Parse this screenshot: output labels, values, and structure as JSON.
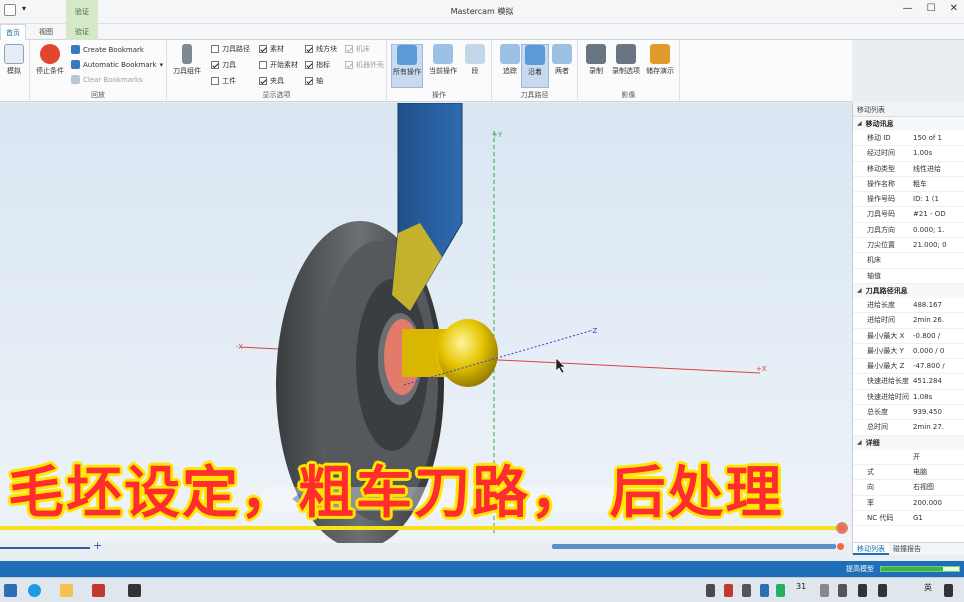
{
  "app": {
    "title": "Mastercam 模拟",
    "context_tab": "验证"
  },
  "tabs": [
    {
      "label": "首页"
    },
    {
      "label": "视图"
    },
    {
      "label": "验证"
    }
  ],
  "ribbon": {
    "sim_label": "模拟",
    "replay": {
      "stop_label": "停止条件",
      "create_bookmark": "Create Bookmark",
      "auto_bookmark": "Automatic Bookmark",
      "clear_bookmarks": "Clear Bookmarks",
      "group": "回放"
    },
    "display": {
      "tool_set": "刀具组件",
      "cols": [
        [
          {
            "label": "刀具路径",
            "checked": false
          },
          {
            "label": "刀具",
            "checked": true
          },
          {
            "label": "工件",
            "checked": false
          }
        ],
        [
          {
            "label": "素材",
            "checked": true
          },
          {
            "label": "开始素材",
            "checked": false
          },
          {
            "label": "夹具",
            "checked": true
          }
        ],
        [
          {
            "label": "线方块",
            "checked": true
          },
          {
            "label": "指标",
            "checked": true
          },
          {
            "label": "轴",
            "checked": true
          }
        ],
        [
          {
            "label": "机床",
            "checked": true,
            "disabled": true
          },
          {
            "label": "机器外壳",
            "checked": true,
            "disabled": true
          }
        ]
      ],
      "group": "显示选项"
    },
    "operation": {
      "all_ops": "所有操作",
      "current_op": "当前操作",
      "segment": "段",
      "group": "操作"
    },
    "toolpath": {
      "trace": "追踪",
      "follow": "沿着",
      "both": "两者",
      "group": "刀具路径"
    },
    "video": {
      "record": "录制",
      "record_options": "录制选项",
      "save_demo": "储存演示",
      "group": "影像"
    }
  },
  "panel": {
    "title": "移动列表",
    "section_move": "移动讯息",
    "move_rows": [
      {
        "k": "移动 ID",
        "v": "150 of 1"
      },
      {
        "k": "经过时间",
        "v": "1.00s"
      },
      {
        "k": "移动类型",
        "v": "线性进给"
      },
      {
        "k": "操作名称",
        "v": "粗车"
      },
      {
        "k": "操作号码",
        "v": "ID: 1 (1"
      },
      {
        "k": "刀具号码",
        "v": "#21 - OD"
      },
      {
        "k": "刀具方向",
        "v": "0.000; 1."
      },
      {
        "k": "刀尖位置",
        "v": "21.000; 0"
      },
      {
        "k": "机床",
        "v": ""
      },
      {
        "k": "轴值",
        "v": ""
      }
    ],
    "section_path": "刀具路径讯息",
    "path_rows": [
      {
        "k": "进给长度",
        "v": "488.167"
      },
      {
        "k": "进给时间",
        "v": "2min 26."
      },
      {
        "k": "最小/最大 X",
        "v": "-0.800 /"
      },
      {
        "k": "最小/最大 Y",
        "v": "0.000 / 0"
      },
      {
        "k": "最小/最大 Z",
        "v": "-47.800 /"
      },
      {
        "k": "快速进给长度",
        "v": "451.284"
      },
      {
        "k": "快速进给时间",
        "v": "1.08s"
      },
      {
        "k": "总长度",
        "v": "939.450"
      },
      {
        "k": "总时间",
        "v": "2min 27."
      }
    ],
    "section_detail": "详细",
    "detail_rows": [
      {
        "k": "",
        "v": "开"
      },
      {
        "k": "式",
        "v": "电脑"
      },
      {
        "k": "向",
        "v": "右视图"
      },
      {
        "k": "率",
        "v": "200.000"
      },
      {
        "k": "NC 代码",
        "v": "G1"
      }
    ],
    "tab_moves": "移动列表",
    "tab_report": "碰撞报告"
  },
  "viewport": {
    "axis_pos_y": "+Y",
    "axis_neg_x": "-X",
    "axis_pos_x": "+X",
    "axis_neg_z": "-Z"
  },
  "status": {
    "text": "提高模型",
    "progress_pct": 80
  },
  "taskbar": {
    "tray_date": "31",
    "ime": "英"
  },
  "caption": "毛坯设定，粗车刀路， 后处理"
}
